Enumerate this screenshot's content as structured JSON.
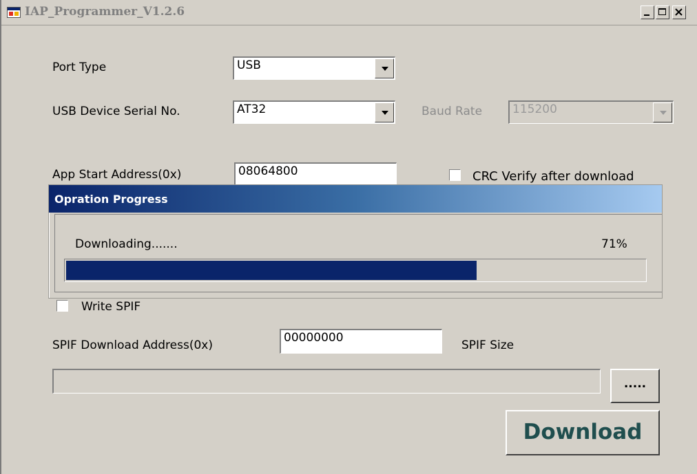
{
  "window": {
    "title": "IAP_Programmer_V1.2.6",
    "icon": "app-window-icon"
  },
  "form": {
    "port_type_label": "Port Type",
    "port_type_value": "USB",
    "usb_serial_label": "USB Device Serial No.",
    "usb_serial_value": "AT32",
    "baud_rate_label": "Baud Rate",
    "baud_rate_value": "115200",
    "app_start_label": "App Start Address(0x)",
    "app_start_value": "08064800",
    "crc_label": "CRC Verify after download",
    "crc_checked": false,
    "write_spif_label": "Write SPIF",
    "write_spif_checked": false,
    "spif_addr_label": "SPIF Download Address(0x)",
    "spif_addr_value": "00000000",
    "spif_size_label": "SPIF Size",
    "spif_file_value": "",
    "browse_label": ".....",
    "download_label": "Download"
  },
  "progress_dialog": {
    "title": "Opration Progress",
    "status_text": "Downloading.......",
    "percent_text": "71%",
    "percent": 71
  },
  "colors": {
    "dialog_face": "#d4d0c8",
    "progress_fill": "#0a246a",
    "download_text": "#1f4e4e"
  }
}
